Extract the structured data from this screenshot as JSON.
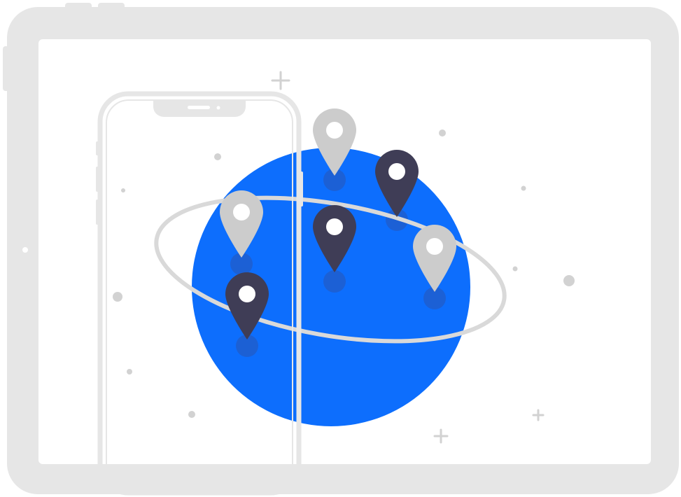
{
  "illustration": {
    "subject": "",
    "colors": {
      "background": "#ffffff",
      "device_frame": "#e6e6e6",
      "device_screen": "#ffffff",
      "phone_outline": "#e6e6e6",
      "globe": "#0d6efd",
      "globe_shadow": "#2f5fc8",
      "orbit_ring": "#d9d9d9",
      "pin_dark": "#3f3d56",
      "pin_light": "#cccccc",
      "pin_hole": "#ffffff",
      "sparkle": "#cfcfcf"
    },
    "pins": [
      {
        "name": "light-pin-top",
        "tone": "light"
      },
      {
        "name": "dark-pin-upper-right",
        "tone": "dark"
      },
      {
        "name": "dark-pin-center",
        "tone": "dark"
      },
      {
        "name": "light-pin-right",
        "tone": "light"
      },
      {
        "name": "light-pin-left",
        "tone": "light"
      },
      {
        "name": "dark-pin-lower-left",
        "tone": "dark"
      }
    ]
  }
}
